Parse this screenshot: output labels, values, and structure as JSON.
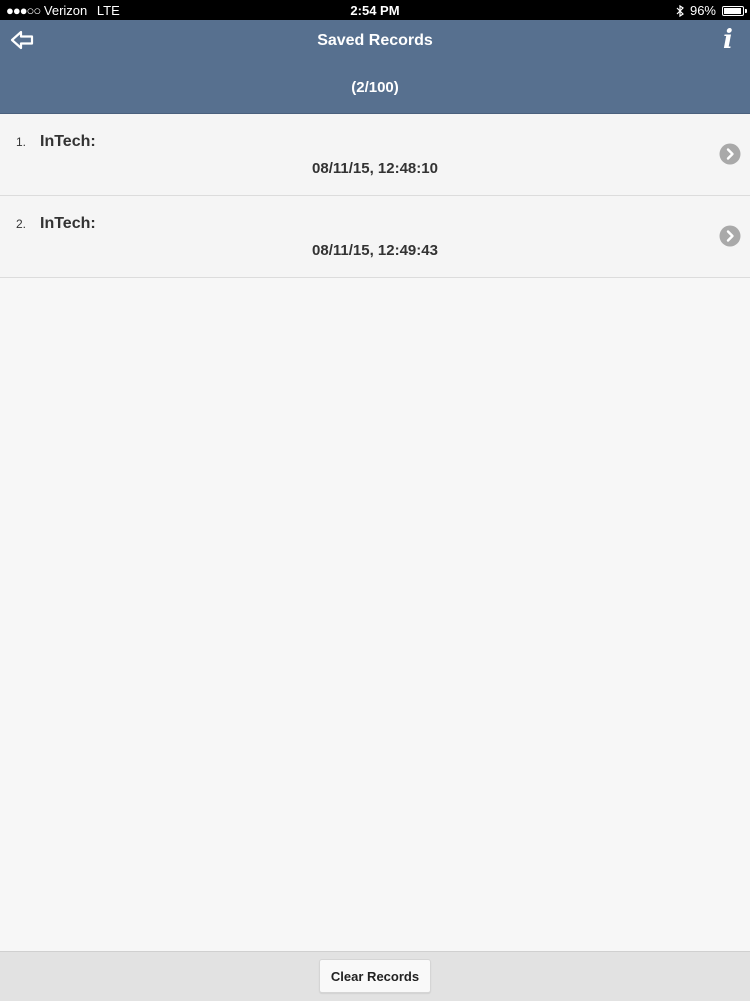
{
  "status_bar": {
    "signal": "●●●○○",
    "carrier": "Verizon",
    "network": "LTE",
    "time": "2:54 PM",
    "bluetooth_icon": "bluetooth-icon",
    "battery_percent": "96%",
    "battery_level": 0.96
  },
  "nav": {
    "title": "Saved Records",
    "subtitle": "(2/100)",
    "back_icon": "back-arrow-icon",
    "info_icon": "info-icon",
    "info_glyph": "i"
  },
  "records": [
    {
      "index": "1.",
      "name": "InTech:",
      "timestamp": "08/11/15, 12:48:10"
    },
    {
      "index": "2.",
      "name": "InTech:",
      "timestamp": "08/11/15, 12:49:43"
    }
  ],
  "footer": {
    "clear_label": "Clear Records"
  },
  "colors": {
    "nav_background": "#57708f",
    "list_background": "#f5f5f5",
    "chevron": "#a9a9a9"
  }
}
